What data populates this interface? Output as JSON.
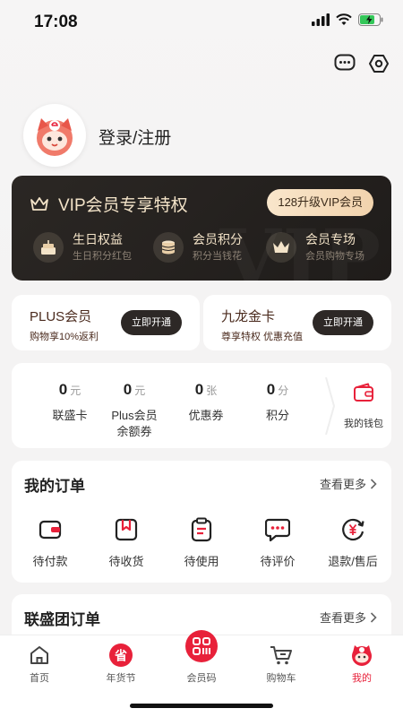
{
  "status_bar": {
    "time": "17:08"
  },
  "user": {
    "login_label": "登录/注册"
  },
  "vip": {
    "title": "VIP会员专享特权",
    "upgrade_label": "128升级VIP会员",
    "benefits": [
      {
        "title": "生日权益",
        "subtitle": "生日积分红包",
        "icon": "cake-icon"
      },
      {
        "title": "会员积分",
        "subtitle": "积分当钱花",
        "icon": "coin-stack-icon"
      },
      {
        "title": "会员专场",
        "subtitle": "会员购物专场",
        "icon": "crown-icon"
      }
    ]
  },
  "memberships": [
    {
      "title": "PLUS会员",
      "subtitle": "购物享10%返利",
      "button": "立即开通"
    },
    {
      "title": "九龙金卡",
      "subtitle": "尊享特权 优惠充值",
      "button": "立即开通"
    }
  ],
  "assets": [
    {
      "value": "0",
      "unit": "元",
      "label": "联盛卡"
    },
    {
      "value": "0",
      "unit": "元",
      "label": "Plus会员\n余额券"
    },
    {
      "value": "0",
      "unit": "张",
      "label": "优惠券"
    },
    {
      "value": "0",
      "unit": "分",
      "label": "积分"
    }
  ],
  "wallet": {
    "label": "我的钱包"
  },
  "orders": {
    "title": "我的订单",
    "see_more": "查看更多",
    "items": [
      {
        "label": "待付款",
        "icon": "wallet-icon"
      },
      {
        "label": "待收货",
        "icon": "package-icon"
      },
      {
        "label": "待使用",
        "icon": "clipboard-icon"
      },
      {
        "label": "待评价",
        "icon": "comment-icon"
      },
      {
        "label": "退款/售后",
        "icon": "refund-icon"
      }
    ]
  },
  "group_orders": {
    "title": "联盛团订单",
    "see_more": "查看更多"
  },
  "tabbar": {
    "items": [
      {
        "label": "首页",
        "icon": "home-icon"
      },
      {
        "label": "年货节",
        "icon": "festival-icon"
      },
      {
        "label": "会员码",
        "icon": "member-code-icon"
      },
      {
        "label": "购物车",
        "icon": "cart-icon"
      },
      {
        "label": "我的",
        "icon": "profile-icon"
      }
    ],
    "active_index": 4
  },
  "colors": {
    "accent": "#e8213a",
    "vip_gold": "#f3e3c8",
    "vip_bg": "#231f1c"
  }
}
